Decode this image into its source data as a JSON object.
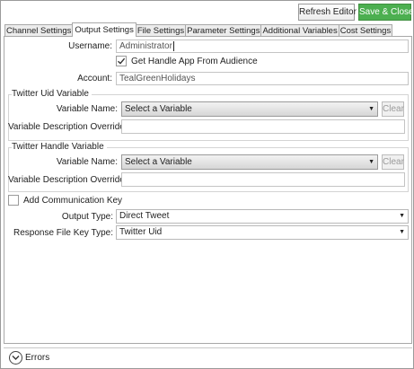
{
  "toolbar": {
    "refresh_label": "Refresh Editor",
    "save_label": "Save & Close"
  },
  "tabs": [
    {
      "label": "Channel Settings"
    },
    {
      "label": "Output Settings",
      "active": true
    },
    {
      "label": "File Settings"
    },
    {
      "label": "Parameter Settings"
    },
    {
      "label": "Additional Variables"
    },
    {
      "label": "Cost Settings"
    }
  ],
  "form": {
    "username_label": "Username:",
    "username_value": "Administrator",
    "get_handle_label": "Get Handle App From Audience",
    "get_handle_checked": true,
    "account_label": "Account:",
    "account_value": "TealGreenHolidays",
    "uid_group_title": "Twitter Uid Variable",
    "uid_variable_name_label": "Variable Name:",
    "uid_variable_value": "Select a Variable",
    "uid_clear_label": "Clear",
    "uid_desc_label": "Variable Description Override:",
    "uid_desc_value": "",
    "handle_group_title": "Twitter Handle Variable",
    "handle_variable_name_label": "Variable Name:",
    "handle_variable_value": "Select a Variable",
    "handle_clear_label": "Clear",
    "handle_desc_label": "Variable Description Override:",
    "handle_desc_value": "",
    "add_comm_key_label": "Add Communication Key",
    "add_comm_key_checked": false,
    "output_type_label": "Output Type:",
    "output_type_value": "Direct Tweet",
    "response_key_label": "Response File Key Type:",
    "response_key_value": "Twitter Uid"
  },
  "footer": {
    "errors_label": "Errors"
  },
  "icons": {
    "dropdown": "triangle-down-icon",
    "expand": "chevron-down-circle-icon",
    "check": "checkmark-icon"
  },
  "colors": {
    "save_button": "#4caf50"
  }
}
